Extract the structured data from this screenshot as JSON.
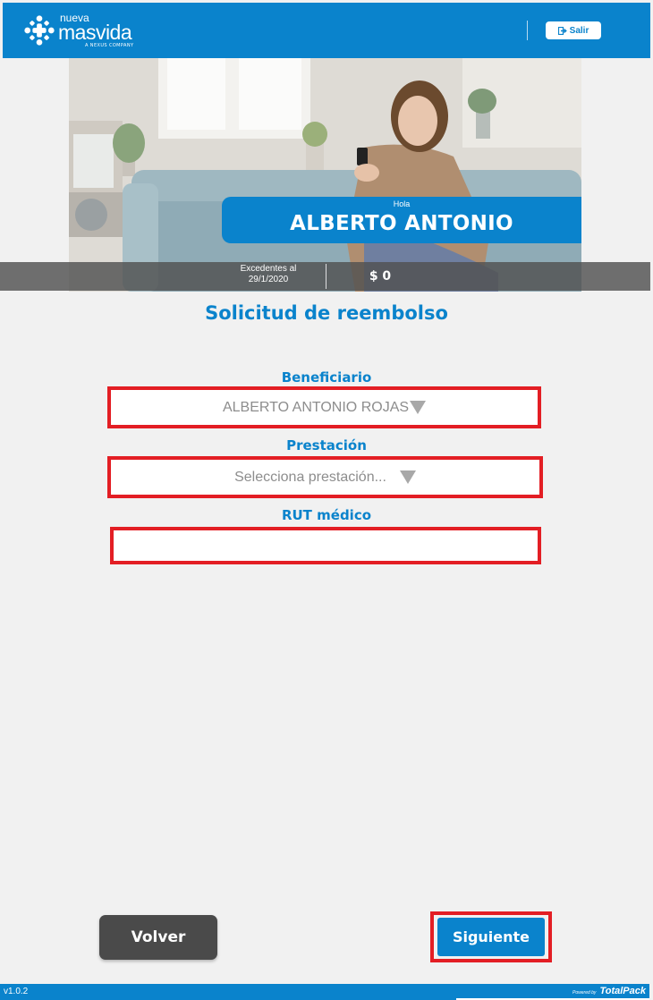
{
  "header": {
    "logo_top": "nueva",
    "logo_main": "masvida",
    "logo_sub": "A NEXUS COMPANY",
    "logout_label": "Salir"
  },
  "hero": {
    "greeting": "Hola",
    "user_name": "ALBERTO ANTONIO",
    "balance_label_line1": "Excedentes al",
    "balance_label_line2": "29/1/2020",
    "balance_amount": "$ 0"
  },
  "form": {
    "title": "Solicitud de reembolso",
    "beneficiary": {
      "label": "Beneficiario",
      "selected": "ALBERTO ANTONIO ROJAS"
    },
    "service": {
      "label": "Prestación",
      "selected": "Selecciona prestación..."
    },
    "doctor_rut": {
      "label": "RUT médico",
      "value": "",
      "placeholder": ""
    }
  },
  "actions": {
    "back_label": "Volver",
    "next_label": "Siguiente"
  },
  "footer": {
    "version": "v1.0.2",
    "powered_by": "Powered by",
    "brand": "TotalPack"
  },
  "colors": {
    "primary": "#0a83cc",
    "highlight": "#e31e24",
    "dark_button": "#4a4a4a",
    "background": "#f1f1f1"
  }
}
